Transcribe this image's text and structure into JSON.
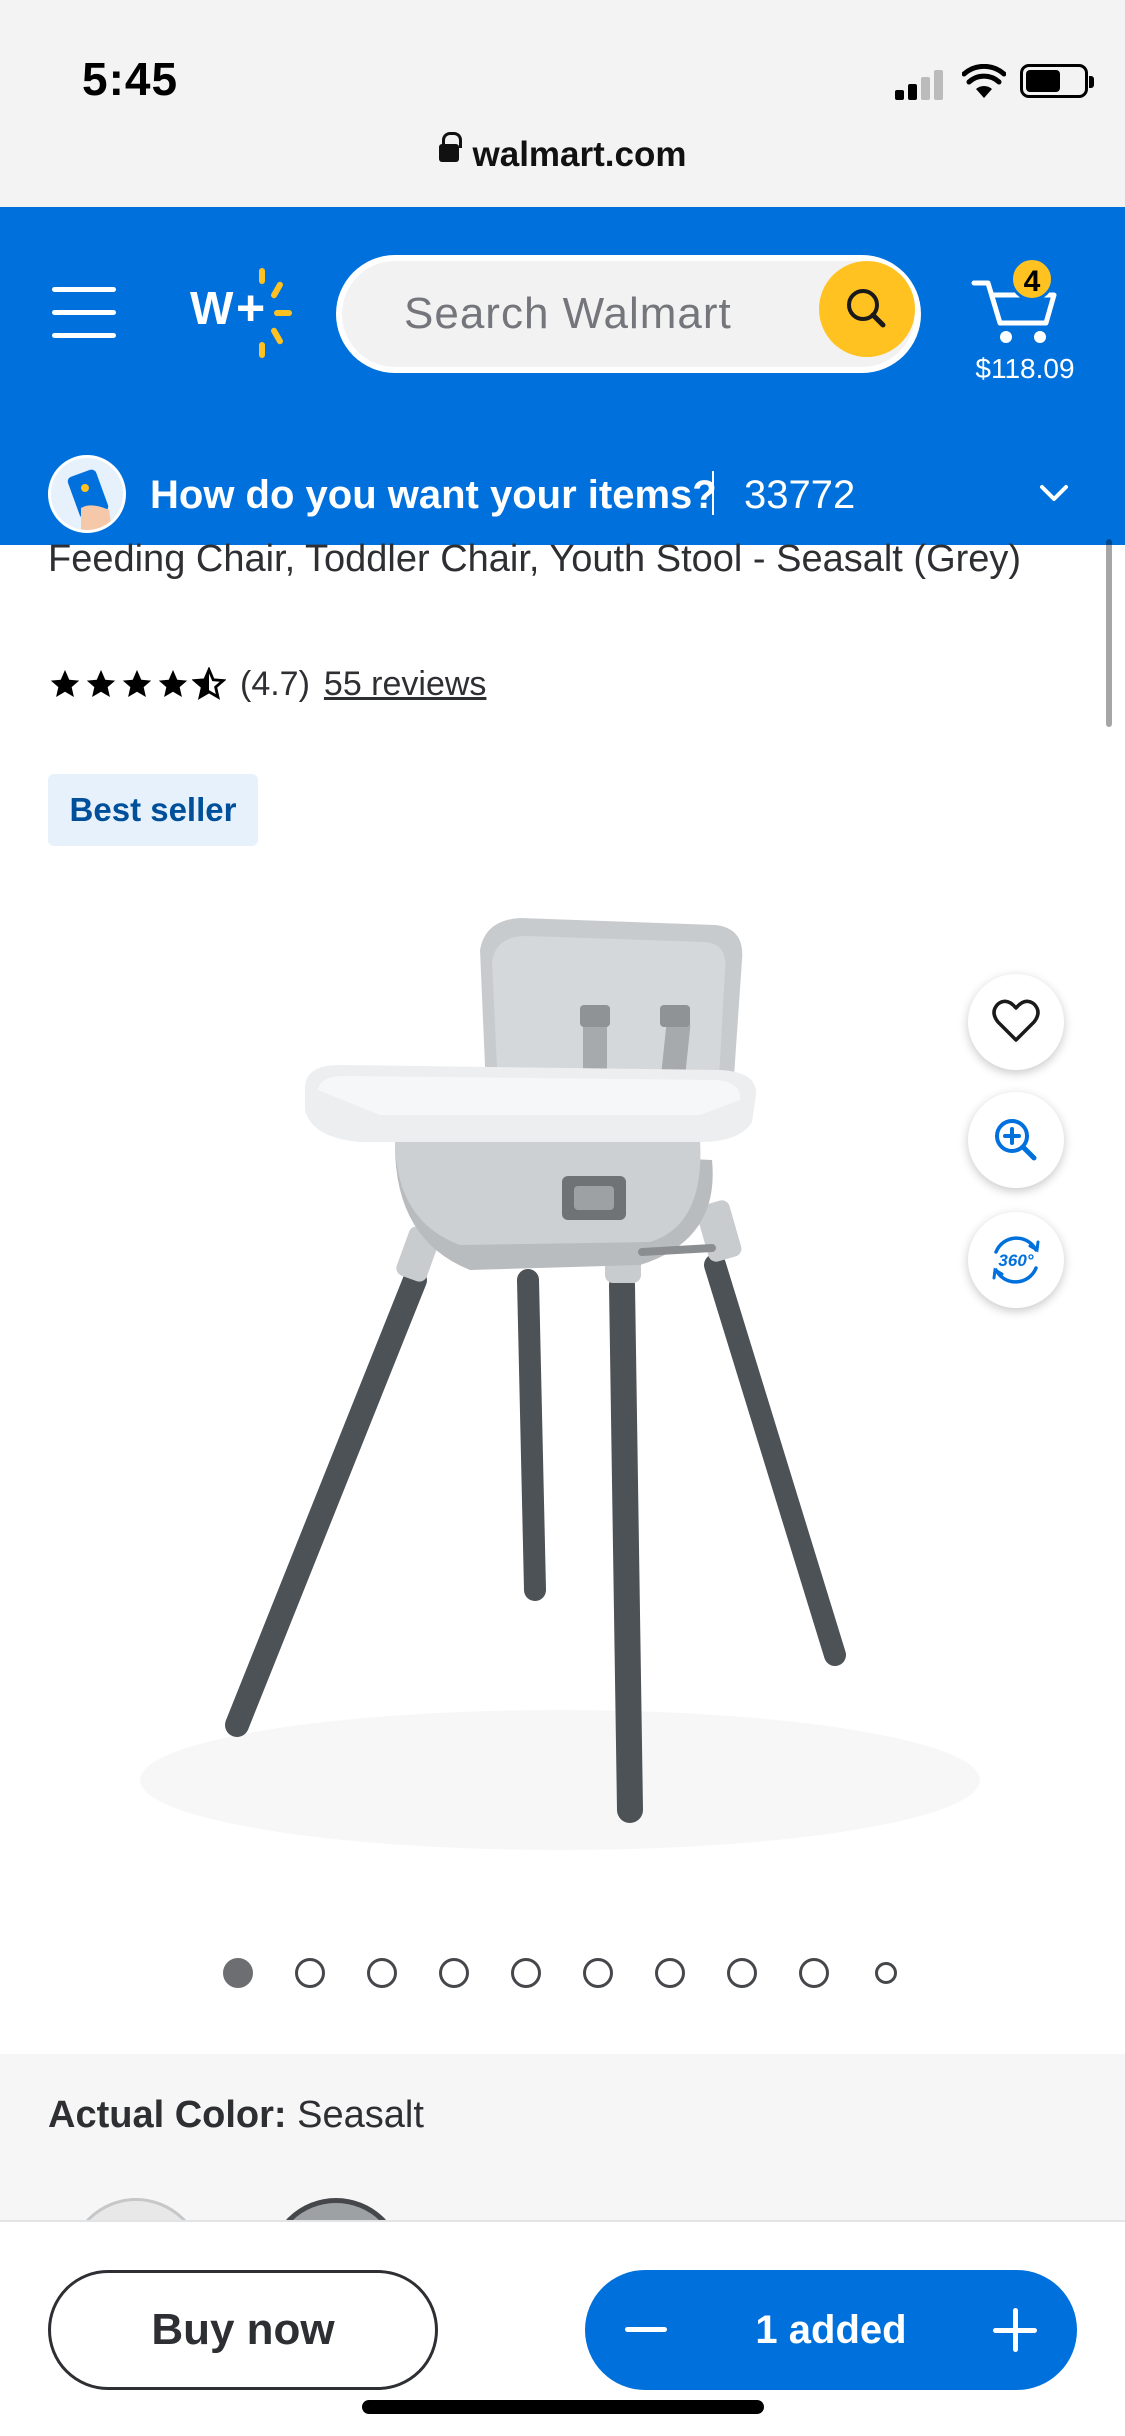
{
  "status_bar": {
    "time": "5:45",
    "battery_level": 0.6
  },
  "browser": {
    "url": "walmart.com"
  },
  "header": {
    "search_placeholder": "Search Walmart",
    "cart": {
      "count": "4",
      "total": "$118.09"
    },
    "delivery": {
      "prompt": "How do you want your items?",
      "zip": "33772"
    },
    "colors": {
      "brand_blue": "#0071dc",
      "spark_yellow": "#ffc220"
    }
  },
  "product": {
    "title": "Feeding Chair, Toddler Chair, Youth Stool - Seasalt (Grey)",
    "rating_value": 4.7,
    "rating_text": "(4.7)",
    "reviews": "55 reviews",
    "badge": "Best seller",
    "image_count": 10,
    "active_image": 0,
    "actions": {
      "favorite": "heart-icon",
      "zoom": "zoom-in-icon",
      "view360": "360-view-icon"
    },
    "color_label": "Actual Color:",
    "color_value": "Seasalt"
  },
  "bottom_bar": {
    "buy_now": "Buy now",
    "qty_label": "1 added"
  }
}
